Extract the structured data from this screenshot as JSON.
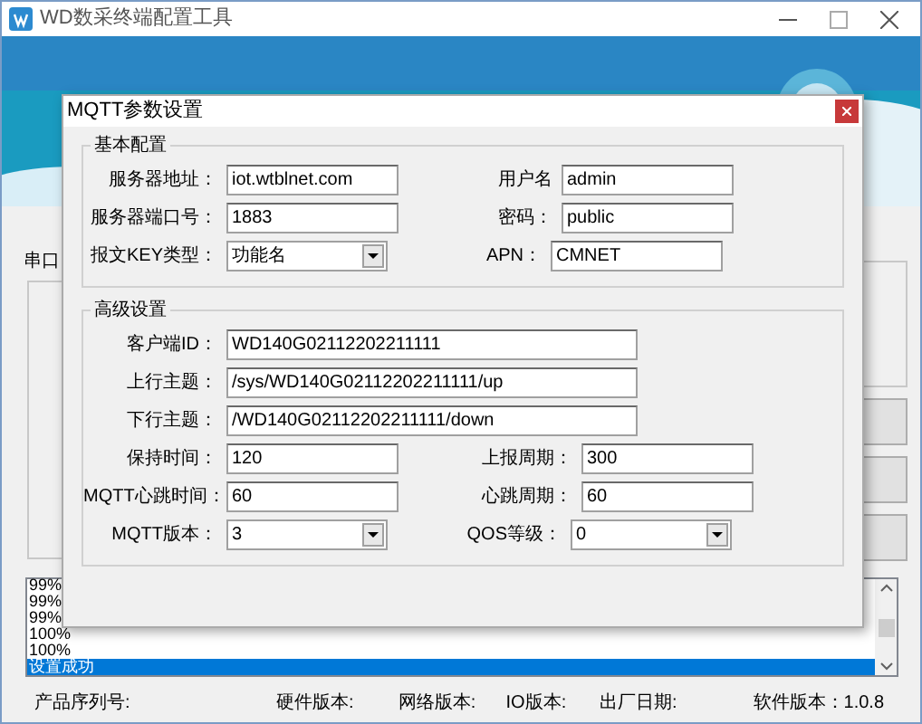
{
  "window": {
    "title": "WD数采终端配置工具"
  },
  "main": {
    "port_label": "串口"
  },
  "log": {
    "lines": [
      {
        "text": "99%",
        "selected": false
      },
      {
        "text": "99%",
        "selected": false
      },
      {
        "text": "99%",
        "selected": false
      },
      {
        "text": "100%",
        "selected": false
      },
      {
        "text": "100%",
        "selected": false
      },
      {
        "text": "设置成功",
        "selected": true
      }
    ]
  },
  "status_bar": [
    "产品序列号:",
    "硬件版本:",
    "网络版本:",
    "IO版本:",
    "出厂日期:",
    "软件版本：1.0.8"
  ],
  "dialog": {
    "title": "MQTT参数设置",
    "groups": [
      {
        "title": "基本配置",
        "rows": [
          [
            {
              "label": "服务器地址：",
              "value": "iot.wtblnet.com",
              "kind": "input"
            },
            {
              "label": "用户名",
              "value": "admin",
              "kind": "input"
            }
          ],
          [
            {
              "label": "服务器端口号：",
              "value": "1883",
              "kind": "input"
            },
            {
              "label": "密码：",
              "value": "public",
              "kind": "input"
            }
          ],
          [
            {
              "label": "报文KEY类型：",
              "value": "功能名",
              "kind": "select"
            },
            {
              "label": "APN：",
              "value": "CMNET",
              "kind": "input"
            }
          ]
        ]
      },
      {
        "title": "高级设置",
        "rows": [
          [
            {
              "label": "客户端ID：",
              "value": "WD140G02112202211111",
              "kind": "wide"
            }
          ],
          [
            {
              "label": "上行主题：",
              "value": "/sys/WD140G02112202211111/up",
              "kind": "wide"
            }
          ],
          [
            {
              "label": "下行主题：",
              "value": "/WD140G02112202211111/down",
              "kind": "wide"
            }
          ],
          [
            {
              "label": "保持时间：",
              "value": "120",
              "kind": "input"
            },
            {
              "label": "上报周期：",
              "value": "300",
              "kind": "input"
            }
          ],
          [
            {
              "label": "MQTT心跳时间：",
              "value": "60",
              "kind": "input"
            },
            {
              "label": "心跳周期：",
              "value": "60",
              "kind": "input"
            }
          ],
          [
            {
              "label": "MQTT版本：",
              "value": "3",
              "kind": "select"
            },
            {
              "label": "QOS等级：",
              "value": "0",
              "kind": "select"
            }
          ]
        ]
      }
    ]
  }
}
